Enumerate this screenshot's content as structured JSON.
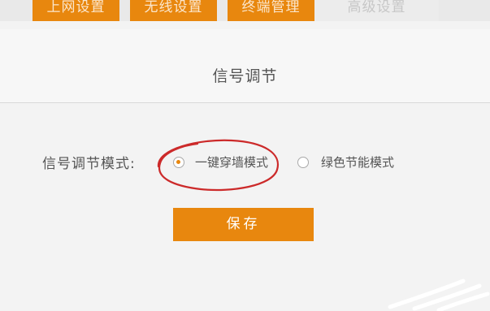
{
  "nav": {
    "tabs": [
      {
        "label": "上网设置"
      },
      {
        "label": "无线设置"
      },
      {
        "label": "终端管理"
      },
      {
        "label": "高级设置"
      }
    ]
  },
  "page": {
    "title": "信号调节"
  },
  "signal": {
    "mode_label": "信号调节模式:",
    "options": [
      {
        "label": "一键穿墙模式",
        "selected": true
      },
      {
        "label": "绿色节能模式",
        "selected": false
      }
    ]
  },
  "actions": {
    "save_label": "保存"
  },
  "colors": {
    "accent": "#e8870e",
    "annotation": "#cc2a2a"
  }
}
